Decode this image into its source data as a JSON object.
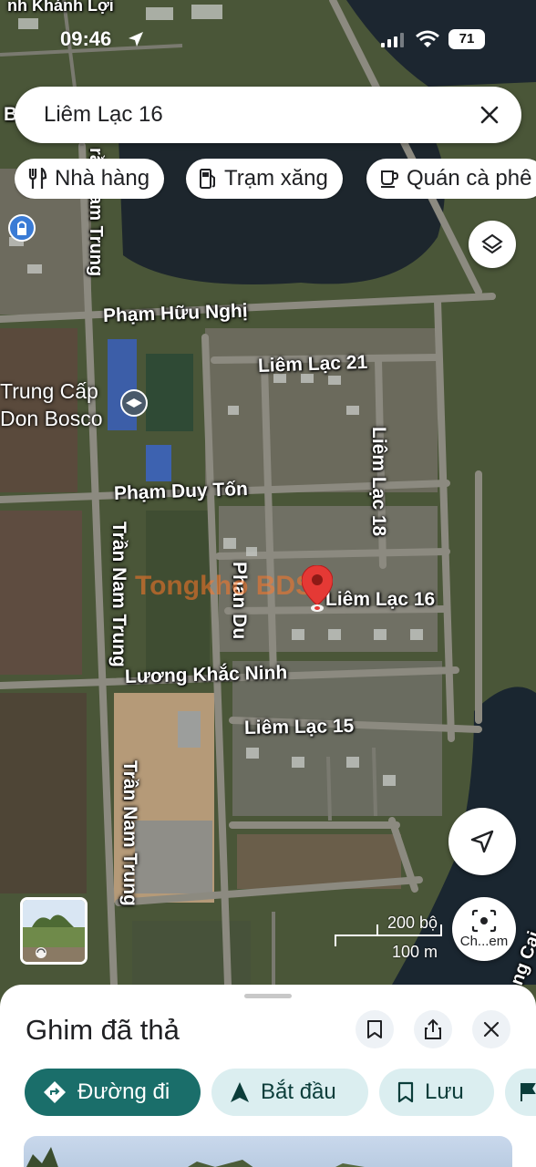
{
  "status_bar": {
    "time": "09:46",
    "battery": "71"
  },
  "search": {
    "query": "Liêm Lạc 16"
  },
  "chips": [
    {
      "label": "Nhà hàng",
      "icon": "restaurant-icon"
    },
    {
      "label": "Trạm xăng",
      "icon": "gas-station-icon"
    },
    {
      "label": "Quán cà phê",
      "icon": "coffee-icon"
    }
  ],
  "map": {
    "top_partial_label": "nh Khánh Lợi",
    "roads": [
      "Phạm Hữu Nghị",
      "Liêm Lạc 21",
      "Liêm Lạc 18",
      "Phạm Duy Tốn",
      "Trần Nam Trung",
      "Phan Du",
      "Liêm Lạc 16",
      "Lương Khắc Ninh",
      "Liêm Lạc 15",
      "Trần Nam Trung",
      "rần Nam Trung",
      "ng Cai"
    ],
    "poi": {
      "line1": "Trung Cấp",
      "line2": "Don Bosco"
    },
    "watermark": "Tongkho BDS",
    "edge_letter": "B"
  },
  "scale": {
    "imperial": "200 bộ",
    "metric": "100 m"
  },
  "buttons": {
    "layers_icon": "layers-icon",
    "navigate_icon": "navigation-arrow-icon",
    "lens_label": "Ch...em"
  },
  "sheet": {
    "title": "Ghim đã thả",
    "actions": [
      {
        "label": "Đường đi",
        "icon": "directions-icon"
      },
      {
        "label": "Bắt đầu",
        "icon": "start-navigation-icon"
      },
      {
        "label": "Lưu",
        "icon": "bookmark-icon"
      }
    ]
  },
  "colors": {
    "accent": "#1a6e6a",
    "chip_bg": "#dbeef0",
    "pin": "#e53935",
    "water": "#1c2630"
  }
}
